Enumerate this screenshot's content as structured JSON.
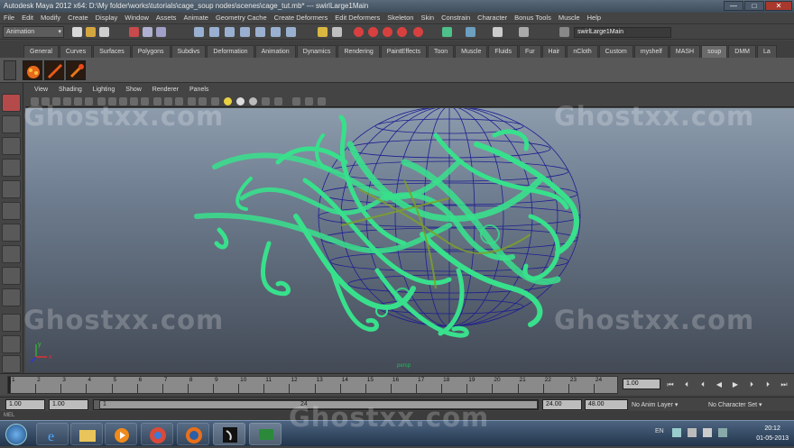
{
  "window": {
    "title": "Autodesk Maya 2012 x64: D:\\My folder\\works\\tutorials\\cage_soup nodes\\scenes\\cage_tut.mb*   ---   swirlLarge1Main",
    "controls": [
      "—",
      "□",
      "✕"
    ]
  },
  "menubar": [
    "File",
    "Edit",
    "Modify",
    "Create",
    "Display",
    "Window",
    "Assets",
    "Animate",
    "Geometry Cache",
    "Create Deformers",
    "Edit Deformers",
    "Skeleton",
    "Skin",
    "Constrain",
    "Character",
    "Bonus Tools",
    "Muscle",
    "Help"
  ],
  "status_line": {
    "mode": "Animation",
    "object_name": "swirlLarge1Main"
  },
  "shelf": {
    "tabs": [
      "General",
      "Curves",
      "Surfaces",
      "Polygons",
      "Subdivs",
      "Deformation",
      "Animation",
      "Dynamics",
      "Rendering",
      "PaintEffects",
      "Toon",
      "Muscle",
      "Fluids",
      "Fur",
      "Hair",
      "nCloth",
      "Custom",
      "myshelf",
      "MASH",
      "soup",
      "DMM",
      "La"
    ],
    "active_tab": "soup",
    "icons": [
      "soup-fx-icon",
      "soup-stick-icon",
      "soup-plug-icon"
    ]
  },
  "panel_menu": [
    "View",
    "Shading",
    "Lighting",
    "Show",
    "Renderer",
    "Panels"
  ],
  "viewport": {
    "axis_labels": {
      "y": "y",
      "x": "x"
    },
    "camera_label": "persp",
    "wire_color": "#3be890",
    "sphere_color": "#1a1a8a"
  },
  "watermark": "Ghostxx.com",
  "time_slider": {
    "ticks": [
      "1",
      "2",
      "3",
      "4",
      "5",
      "6",
      "7",
      "8",
      "9",
      "10",
      "11",
      "12",
      "13",
      "14",
      "15",
      "16",
      "17",
      "18",
      "19",
      "20",
      "21",
      "22",
      "23",
      "24"
    ],
    "current_frame": "1.00"
  },
  "range_slider": {
    "start_time": "1.00",
    "playback_start": "1.00",
    "thumb_start": "1",
    "thumb_end": "24",
    "playback_end": "24.00",
    "end_time": "48.00",
    "anim_layer": "No Anim Layer",
    "character_set": "No Character Set"
  },
  "help_line": "MEL",
  "taskbar": {
    "language": "EN",
    "time": "20:12",
    "date": "01-05-2013"
  }
}
